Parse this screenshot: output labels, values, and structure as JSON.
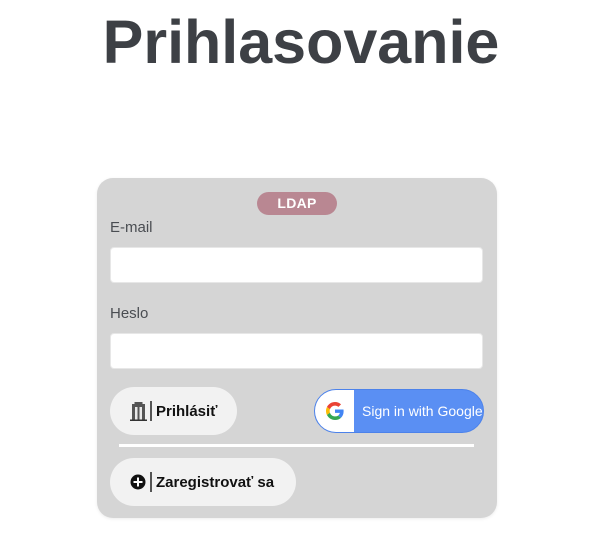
{
  "page": {
    "title": "Prihlasovanie"
  },
  "login_card": {
    "badge": "LDAP",
    "email": {
      "label": "E-mail",
      "value": "",
      "placeholder": ""
    },
    "password": {
      "label": "Heslo",
      "value": "",
      "placeholder": ""
    },
    "login_button": {
      "label": "Prihlásiť",
      "icon": "door-enter-icon"
    },
    "google_button": {
      "label": "Sign in with Google",
      "icon": "google-g-icon"
    },
    "register_button": {
      "label": "Zaregistrovať sa",
      "icon": "plus-circle-icon"
    }
  },
  "colors": {
    "page_background": "#ffffff",
    "title_text": "#3d4045",
    "card_background": "#d5d5d5",
    "badge_background": "#b98792",
    "button_background": "#f2f2f2",
    "google_blue": "#5a8ff3"
  }
}
